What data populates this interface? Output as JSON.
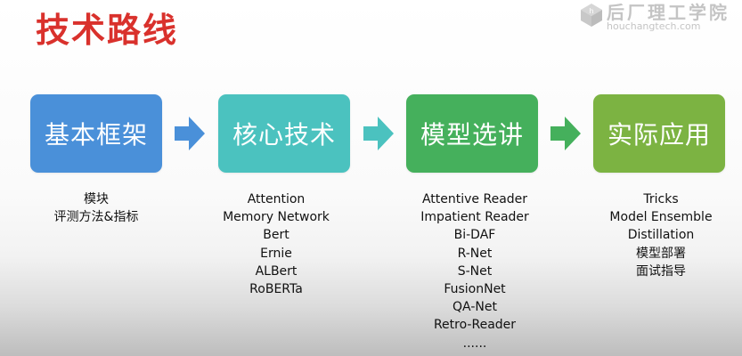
{
  "title": "技术路线",
  "logo": {
    "name": "后厂理工学院",
    "url": "houchangtech.com"
  },
  "stages": [
    {
      "label": "基本框架",
      "color": "#4a90d9",
      "items": [
        "模块",
        "评测方法&指标"
      ]
    },
    {
      "label": "核心技术",
      "color": "#4bc2bf",
      "items": [
        "Attention",
        "Memory Network",
        "Bert",
        "Ernie",
        "ALBert",
        "RoBERTa"
      ]
    },
    {
      "label": "模型选讲",
      "color": "#45b05c",
      "items": [
        "Attentive Reader",
        "Impatient Reader",
        "Bi-DAF",
        "R-Net",
        "S-Net",
        "FusionNet",
        "QA-Net",
        "Retro-Reader",
        "......"
      ]
    },
    {
      "label": "实际应用",
      "color": "#7cb342",
      "items": [
        "Tricks",
        "Model Ensemble",
        "Distillation",
        "模型部署",
        "面试指导"
      ]
    }
  ],
  "arrow_colors": [
    "#4a90d9",
    "#4bc2bf",
    "#45b05c"
  ]
}
